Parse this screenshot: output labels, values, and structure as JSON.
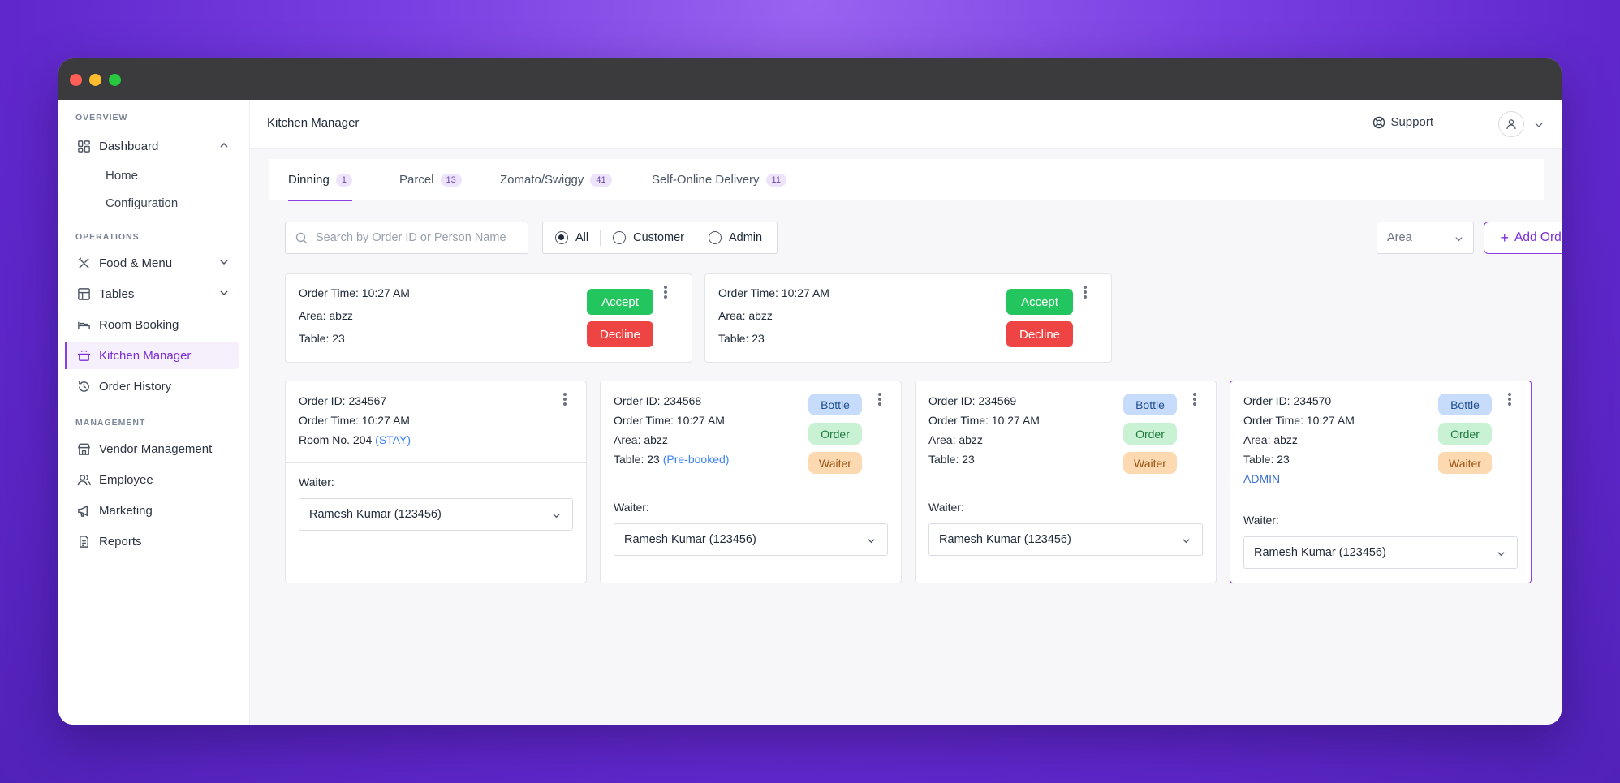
{
  "window": {
    "title": ""
  },
  "sidebar": {
    "sections": {
      "overview": "OVERVIEW",
      "operations": "OPERATIONS",
      "management": "MANAGEMENT"
    },
    "dashboard": {
      "label": "Dashboard",
      "sub": [
        "Home",
        "Configuration"
      ]
    },
    "items": {
      "food": "Food & Menu",
      "tables": "Tables",
      "room": "Room Booking",
      "kitchen": "Kitchen Manager",
      "history": "Order History",
      "vendor": "Vendor Management",
      "employee": "Employee",
      "marketing": "Marketing",
      "reports": "Reports"
    },
    "active": "Kitchen Manager"
  },
  "header": {
    "title": "Kitchen Manager",
    "support": "Support"
  },
  "tabs": [
    {
      "label": "Dinning",
      "count": "1",
      "active": true
    },
    {
      "label": "Parcel",
      "count": "13"
    },
    {
      "label": "Zomato/Swiggy",
      "count": "41"
    },
    {
      "label": "Self-Online Delivery",
      "count": "11"
    }
  ],
  "filters": {
    "search_placeholder": "Search by Order ID or Person Name",
    "radios": [
      "All",
      "Customer",
      "Admin"
    ],
    "selected": "All",
    "area_label": "Area",
    "add_order": "Add Order"
  },
  "requests": [
    {
      "time": "Order Time: 10:27 AM",
      "area": "Area: abzz",
      "table": "Table: 23",
      "accept": "Accept",
      "decline": "Decline"
    },
    {
      "time": "Order Time: 10:27 AM",
      "area": "Area: abzz",
      "table": "Table: 23",
      "accept": "Accept",
      "decline": "Decline"
    }
  ],
  "orders": [
    {
      "id": "Order ID: 234567",
      "time": "Order Time: 10:27 AM",
      "room": "Room No. 204",
      "room_tag": "(STAY)",
      "waiter_label": "Waiter:",
      "waiter": "Ramesh Kumar (123456)"
    },
    {
      "id": "Order ID: 234568",
      "time": "Order Time: 10:27 AM",
      "area": "Area: abzz",
      "table": "Table: 23",
      "table_tag": "(Pre-booked)",
      "pills": [
        "Bottle",
        "Order",
        "Waiter"
      ],
      "waiter_label": "Waiter:",
      "waiter": "Ramesh Kumar (123456)"
    },
    {
      "id": "Order ID: 234569",
      "time": "Order Time: 10:27 AM",
      "area": "Area: abzz",
      "table": "Table: 23",
      "pills": [
        "Bottle",
        "Order",
        "Waiter"
      ],
      "waiter_label": "Waiter:",
      "waiter": "Ramesh Kumar (123456)"
    },
    {
      "id": "Order ID: 234570",
      "time": "Order Time: 10:27 AM",
      "area": "Area: abzz",
      "table": "Table: 23",
      "admin": "ADMIN",
      "pills": [
        "Bottle",
        "Order",
        "Waiter"
      ],
      "waiter_label": "Waiter:",
      "waiter": "Ramesh Kumar (123456)"
    }
  ],
  "colors": {
    "accent": "#8b3fe6",
    "accept": "#22c55e",
    "decline": "#ef4444"
  }
}
